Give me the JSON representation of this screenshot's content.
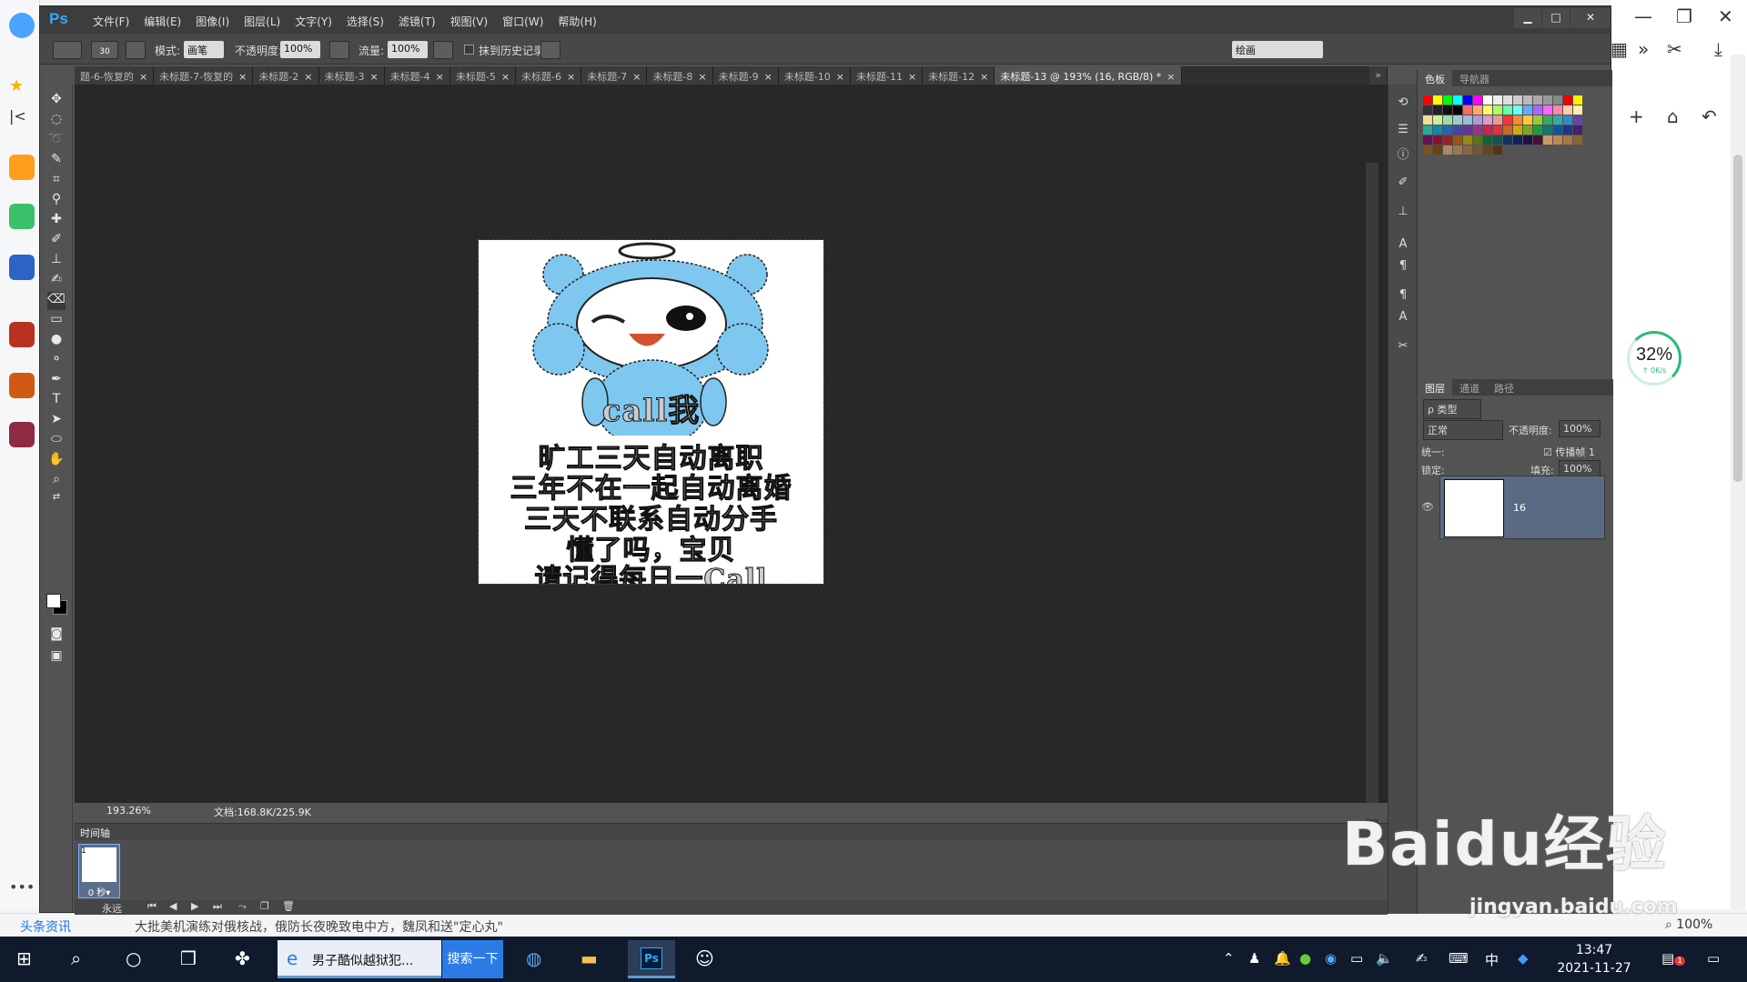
{
  "photoshop": {
    "logo": "Ps",
    "menu": [
      "文件(F)",
      "编辑(E)",
      "图像(I)",
      "图层(L)",
      "文字(Y)",
      "选择(S)",
      "滤镜(T)",
      "视图(V)",
      "窗口(W)",
      "帮助(H)"
    ],
    "window_controls": [
      "▁",
      "□",
      "✕"
    ],
    "options": {
      "brush_size": "30",
      "mode_label": "模式:",
      "mode_value": "画笔",
      "opacity_label": "不透明度:",
      "opacity_value": "100%",
      "flow_label": "流量:",
      "flow_value": "100%",
      "erase_history_label": "抹到历史记录",
      "workspace": "绘画"
    },
    "tabs": [
      "题-6-恢复的",
      "未标题-7-恢复的",
      "未标题-2",
      "未标题-3",
      "未标题-4",
      "未标题-5",
      "未标题-6",
      "未标题-7",
      "未标题-8",
      "未标题-9",
      "未标题-10",
      "未标题-11",
      "未标题-12",
      "未标题-13 @ 193% (16, RGB/8) *"
    ],
    "tab_close": "×",
    "tabs_overflow": "»",
    "canvas_text": {
      "circle": "call我",
      "line1": "旷工三天自动离职",
      "line2": "三年不在一起自动离婚",
      "line3": "三天不联系自动分手",
      "line4": "懂了吗，宝贝",
      "line5": "请记得每日一Call"
    },
    "status": {
      "zoom": "193.26%",
      "doc": "文档:168.8K/225.9K"
    },
    "timeline": {
      "title": "时间轴",
      "frame_number": "1",
      "frame_time": "0 秒▾",
      "loop": "永远"
    },
    "panels": {
      "swatch_tabs": [
        "色板",
        "导航器"
      ],
      "layer_tabs": [
        "图层",
        "通道",
        "路径"
      ],
      "filter_kind": "ρ 类型",
      "blend_mode": "正常",
      "opacity_label": "不透明度:",
      "opacity_value": "100%",
      "unify_label": "统一:",
      "propagate_label": "传播帧 1",
      "lock_label": "锁定:",
      "fill_label": "填充:",
      "fill_value": "100%",
      "layer_name": "16",
      "eye": "👁"
    },
    "swatch_colors": [
      "#ff0000",
      "#ffff00",
      "#00ff00",
      "#00ffff",
      "#0000ff",
      "#ff00ff",
      "#ffffff",
      "#eeeeee",
      "#dddddd",
      "#cccccc",
      "#bbbbbb",
      "#aaaaaa",
      "#999999",
      "#888888",
      "#ee0000",
      "#ffee00",
      "#333333",
      "#222222",
      "#111111",
      "#000000",
      "#ff6666",
      "#ffaa66",
      "#ffff66",
      "#aaff66",
      "#66ffaa",
      "#66ffff",
      "#66aaff",
      "#aa66ff",
      "#ff66ff",
      "#ff88aa",
      "#ffccaa",
      "#ffeeaa",
      "#eedd99",
      "#ccee99",
      "#99ddaa",
      "#99cccc",
      "#99bbdd",
      "#aa99dd",
      "#dd99cc",
      "#ee9999",
      "#ff3333",
      "#ff8833",
      "#ffcc33",
      "#99cc33",
      "#33aa66",
      "#33aaaa",
      "#3388cc",
      "#6644aa",
      "#22aa99",
      "#1188aa",
      "#2266bb",
      "#4444aa",
      "#663399",
      "#993388",
      "#cc2255",
      "#dd3333",
      "#cc6622",
      "#ccaa11",
      "#77aa22",
      "#229944",
      "#117777",
      "#115599",
      "#223388",
      "#442266",
      "#661155",
      "#881133",
      "#992222",
      "#995511",
      "#998811",
      "#557711",
      "#116633",
      "#115555",
      "#113366",
      "#112255",
      "#221144",
      "#441133",
      "#cc9966",
      "#bb8855",
      "#aa7744",
      "#886633",
      "#775522",
      "#664411",
      "#aa8866",
      "#997755",
      "#886644",
      "#775533",
      "#664422",
      "#553311"
    ]
  },
  "browser": {
    "speed_pct": "32%",
    "speed_sub": "↑ 0K/s",
    "news_label": "头条资讯",
    "headline": "大批美机演练对俄核战，俄防长夜晚致电中方，魏凤和送\"定心丸\"",
    "zoom": "100%"
  },
  "taskbar": {
    "browser_task": "男子酷似越狱犯...",
    "search_button": "搜索一下",
    "ime": "中",
    "time": "13:47",
    "date": "2021-11-27",
    "notif_count": "1"
  },
  "watermark": {
    "big": "Baidu经验",
    "small": "jingyan.baidu.com"
  }
}
